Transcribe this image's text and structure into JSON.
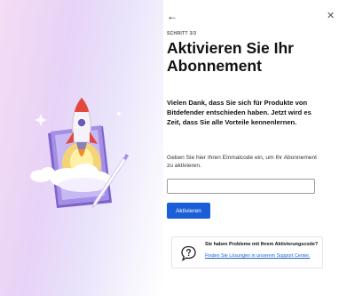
{
  "header": {
    "back_icon": "arrow-left-icon",
    "close_icon": "close-icon",
    "back_glyph": "←",
    "close_glyph": "✕"
  },
  "step_label": "SCHRITT 3/3",
  "title": "Aktivieren Sie Ihr Abonnement",
  "thanks_text": "Vielen Dank, dass Sie sich für Produkte von Bitdefender entschieden haben. Jetzt wird es Zeit, dass Sie alle Vorteile kennenlernen.",
  "instruction_text": "Geben Sie hier Ihren Einmalcode ein, um Ihr Abonnement zu aktivieren.",
  "code_input": {
    "value": "",
    "placeholder": ""
  },
  "activate_button": "Aktivieren",
  "help": {
    "icon": "chat-question-icon",
    "title": "Sie haben Probleme mit Ihrem Aktivierungscode?",
    "link": "Finden Sie Lösungen in unserem Support Center."
  },
  "illustration": "rocket-launch-illustration",
  "colors": {
    "accent": "#1a5fd8",
    "left_panel_gradient_start": "#f4dcf4",
    "left_panel_gradient_end": "#ffffff",
    "rocket_red": "#e4483d"
  }
}
